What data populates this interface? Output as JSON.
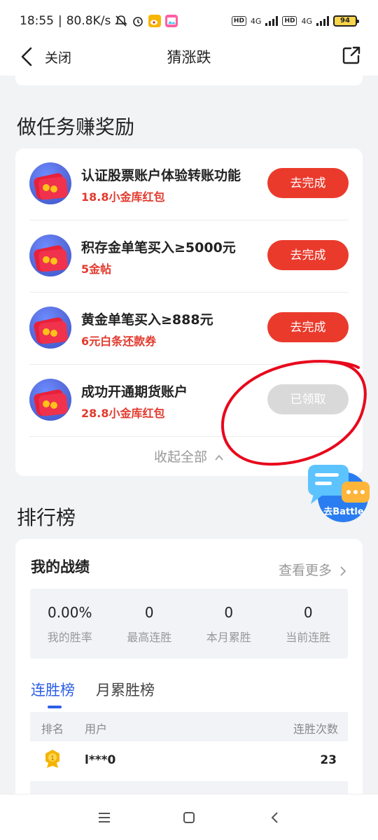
{
  "status": {
    "time": "18:55",
    "speed": "80.8K/s",
    "net_a": "4G",
    "net_b": "4G",
    "hd": "HD",
    "battery": "94"
  },
  "nav": {
    "close_label": "关闭",
    "title": "猜涨跌"
  },
  "tasks_section": {
    "title": "做任务赚奖励",
    "items": [
      {
        "title": "认证股票账户体验转账功能",
        "reward": "18.8小金库红包",
        "button": "去完成",
        "state": "todo"
      },
      {
        "title": "积存金单笔买入≥5000元",
        "reward": "5金帖",
        "button": "去完成",
        "state": "todo"
      },
      {
        "title": "黄金单笔买入≥888元",
        "reward": "6元白条还款券",
        "button": "去完成",
        "state": "todo"
      },
      {
        "title": "成功开通期货账户",
        "reward": "28.8小金库红包",
        "button": "已领取",
        "state": "done"
      }
    ],
    "collapse_label": "收起全部"
  },
  "battle": {
    "label": "去Battle"
  },
  "rank_section": {
    "title": "排行榜",
    "mine_title": "我的战绩",
    "more_label": "查看更多",
    "stats": [
      {
        "value": "0.00%",
        "label": "我的胜率"
      },
      {
        "value": "0",
        "label": "最高连胜"
      },
      {
        "value": "0",
        "label": "本月累胜"
      },
      {
        "value": "0",
        "label": "当前连胜"
      }
    ],
    "tabs": [
      "连胜榜",
      "月累胜榜"
    ],
    "table_headers": {
      "rank": "排名",
      "user": "用户",
      "count": "连胜次数"
    },
    "rows": [
      {
        "rank": "1",
        "user": "l***0",
        "count": "23"
      }
    ]
  },
  "colors": {
    "accent_red": "#ea3a2c",
    "accent_blue": "#2c5fe6",
    "done_gray": "#d9d9d9"
  }
}
